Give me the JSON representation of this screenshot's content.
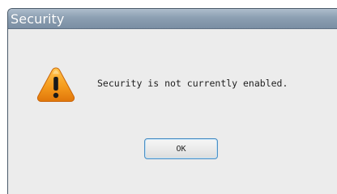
{
  "dialog": {
    "title": "Security",
    "message": "Security is not currently enabled.",
    "icon": "warning-icon",
    "ok_label": "OK"
  },
  "colors": {
    "titlebar": "#8c9fb2",
    "background": "#ececec",
    "warning": "#f39c12",
    "button_focus": "#4d8fc4"
  }
}
